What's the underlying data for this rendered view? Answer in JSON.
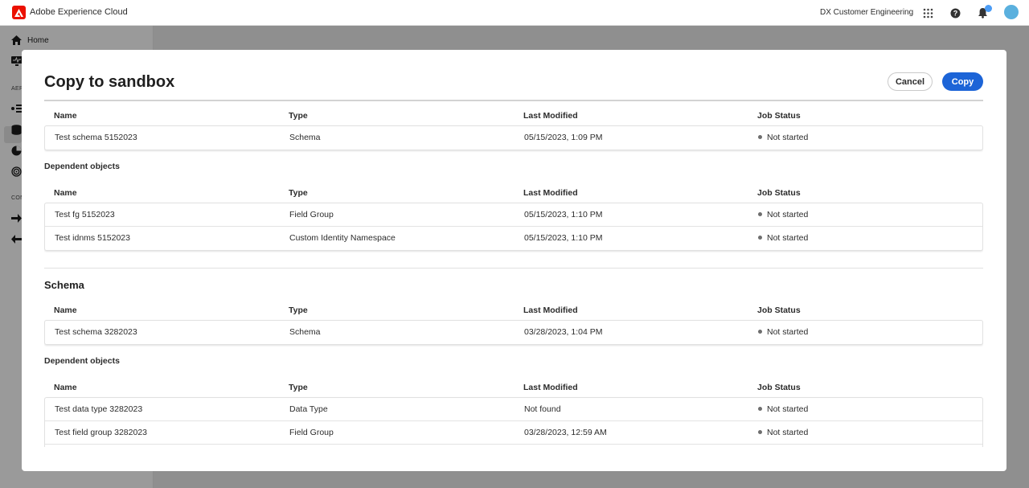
{
  "topbar": {
    "app_title": "Adobe Experience Cloud",
    "org_name": "DX Customer Engineering",
    "icons": [
      "apps-grid-icon",
      "help-icon",
      "bell-icon",
      "avatar"
    ]
  },
  "sidebar": {
    "home_label": "Home",
    "section_aep": "AEP",
    "section_con": "CON"
  },
  "modal": {
    "title": "Copy to sandbox",
    "cancel_label": "Cancel",
    "copy_label": "Copy",
    "columns": {
      "name": "Name",
      "type": "Type",
      "last_modified": "Last Modified",
      "job_status": "Job Status"
    },
    "dependent_heading": "Dependent objects",
    "section_schema_title": "Schema",
    "group1": {
      "main_rows": [
        {
          "name": "Test schema 5152023",
          "type": "Schema",
          "modified": "05/15/2023, 1:09 PM",
          "status": "Not started"
        }
      ],
      "dependent_rows": [
        {
          "name": "Test fg 5152023",
          "type": "Field Group",
          "modified": "05/15/2023, 1:10 PM",
          "status": "Not started"
        },
        {
          "name": "Test idnms 5152023",
          "type": "Custom Identity Namespace",
          "modified": "05/15/2023, 1:10 PM",
          "status": "Not started"
        }
      ]
    },
    "group2": {
      "main_rows": [
        {
          "name": "Test schema 3282023",
          "type": "Schema",
          "modified": "03/28/2023, 1:04 PM",
          "status": "Not started"
        }
      ],
      "dependent_rows": [
        {
          "name": "Test data type 3282023",
          "type": "Data Type",
          "modified": "Not found",
          "status": "Not started"
        },
        {
          "name": "Test field group 3282023",
          "type": "Field Group",
          "modified": "03/28/2023, 12:59 AM",
          "status": "Not started"
        }
      ]
    }
  },
  "colors": {
    "primary_button": "#1c64d7",
    "adobe_red": "#eb1000",
    "status_dot": "#6e6e6e"
  }
}
